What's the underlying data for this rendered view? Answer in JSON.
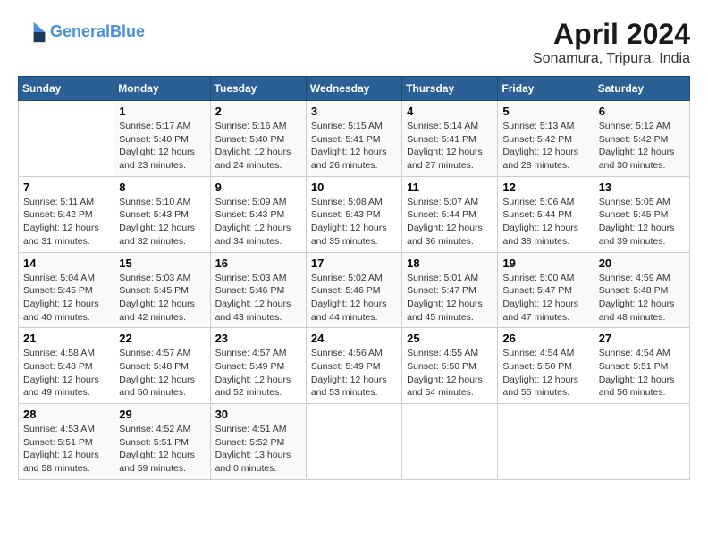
{
  "header": {
    "logo_line1": "General",
    "logo_line2": "Blue",
    "title": "April 2024",
    "subtitle": "Sonamura, Tripura, India"
  },
  "calendar": {
    "days_of_week": [
      "Sunday",
      "Monday",
      "Tuesday",
      "Wednesday",
      "Thursday",
      "Friday",
      "Saturday"
    ],
    "weeks": [
      [
        {
          "day": "",
          "info": ""
        },
        {
          "day": "1",
          "info": "Sunrise: 5:17 AM\nSunset: 5:40 PM\nDaylight: 12 hours\nand 23 minutes."
        },
        {
          "day": "2",
          "info": "Sunrise: 5:16 AM\nSunset: 5:40 PM\nDaylight: 12 hours\nand 24 minutes."
        },
        {
          "day": "3",
          "info": "Sunrise: 5:15 AM\nSunset: 5:41 PM\nDaylight: 12 hours\nand 26 minutes."
        },
        {
          "day": "4",
          "info": "Sunrise: 5:14 AM\nSunset: 5:41 PM\nDaylight: 12 hours\nand 27 minutes."
        },
        {
          "day": "5",
          "info": "Sunrise: 5:13 AM\nSunset: 5:42 PM\nDaylight: 12 hours\nand 28 minutes."
        },
        {
          "day": "6",
          "info": "Sunrise: 5:12 AM\nSunset: 5:42 PM\nDaylight: 12 hours\nand 30 minutes."
        }
      ],
      [
        {
          "day": "7",
          "info": "Sunrise: 5:11 AM\nSunset: 5:42 PM\nDaylight: 12 hours\nand 31 minutes."
        },
        {
          "day": "8",
          "info": "Sunrise: 5:10 AM\nSunset: 5:43 PM\nDaylight: 12 hours\nand 32 minutes."
        },
        {
          "day": "9",
          "info": "Sunrise: 5:09 AM\nSunset: 5:43 PM\nDaylight: 12 hours\nand 34 minutes."
        },
        {
          "day": "10",
          "info": "Sunrise: 5:08 AM\nSunset: 5:43 PM\nDaylight: 12 hours\nand 35 minutes."
        },
        {
          "day": "11",
          "info": "Sunrise: 5:07 AM\nSunset: 5:44 PM\nDaylight: 12 hours\nand 36 minutes."
        },
        {
          "day": "12",
          "info": "Sunrise: 5:06 AM\nSunset: 5:44 PM\nDaylight: 12 hours\nand 38 minutes."
        },
        {
          "day": "13",
          "info": "Sunrise: 5:05 AM\nSunset: 5:45 PM\nDaylight: 12 hours\nand 39 minutes."
        }
      ],
      [
        {
          "day": "14",
          "info": "Sunrise: 5:04 AM\nSunset: 5:45 PM\nDaylight: 12 hours\nand 40 minutes."
        },
        {
          "day": "15",
          "info": "Sunrise: 5:03 AM\nSunset: 5:45 PM\nDaylight: 12 hours\nand 42 minutes."
        },
        {
          "day": "16",
          "info": "Sunrise: 5:03 AM\nSunset: 5:46 PM\nDaylight: 12 hours\nand 43 minutes."
        },
        {
          "day": "17",
          "info": "Sunrise: 5:02 AM\nSunset: 5:46 PM\nDaylight: 12 hours\nand 44 minutes."
        },
        {
          "day": "18",
          "info": "Sunrise: 5:01 AM\nSunset: 5:47 PM\nDaylight: 12 hours\nand 45 minutes."
        },
        {
          "day": "19",
          "info": "Sunrise: 5:00 AM\nSunset: 5:47 PM\nDaylight: 12 hours\nand 47 minutes."
        },
        {
          "day": "20",
          "info": "Sunrise: 4:59 AM\nSunset: 5:48 PM\nDaylight: 12 hours\nand 48 minutes."
        }
      ],
      [
        {
          "day": "21",
          "info": "Sunrise: 4:58 AM\nSunset: 5:48 PM\nDaylight: 12 hours\nand 49 minutes."
        },
        {
          "day": "22",
          "info": "Sunrise: 4:57 AM\nSunset: 5:48 PM\nDaylight: 12 hours\nand 50 minutes."
        },
        {
          "day": "23",
          "info": "Sunrise: 4:57 AM\nSunset: 5:49 PM\nDaylight: 12 hours\nand 52 minutes."
        },
        {
          "day": "24",
          "info": "Sunrise: 4:56 AM\nSunset: 5:49 PM\nDaylight: 12 hours\nand 53 minutes."
        },
        {
          "day": "25",
          "info": "Sunrise: 4:55 AM\nSunset: 5:50 PM\nDaylight: 12 hours\nand 54 minutes."
        },
        {
          "day": "26",
          "info": "Sunrise: 4:54 AM\nSunset: 5:50 PM\nDaylight: 12 hours\nand 55 minutes."
        },
        {
          "day": "27",
          "info": "Sunrise: 4:54 AM\nSunset: 5:51 PM\nDaylight: 12 hours\nand 56 minutes."
        }
      ],
      [
        {
          "day": "28",
          "info": "Sunrise: 4:53 AM\nSunset: 5:51 PM\nDaylight: 12 hours\nand 58 minutes."
        },
        {
          "day": "29",
          "info": "Sunrise: 4:52 AM\nSunset: 5:51 PM\nDaylight: 12 hours\nand 59 minutes."
        },
        {
          "day": "30",
          "info": "Sunrise: 4:51 AM\nSunset: 5:52 PM\nDaylight: 13 hours\nand 0 minutes."
        },
        {
          "day": "",
          "info": ""
        },
        {
          "day": "",
          "info": ""
        },
        {
          "day": "",
          "info": ""
        },
        {
          "day": "",
          "info": ""
        }
      ]
    ]
  }
}
